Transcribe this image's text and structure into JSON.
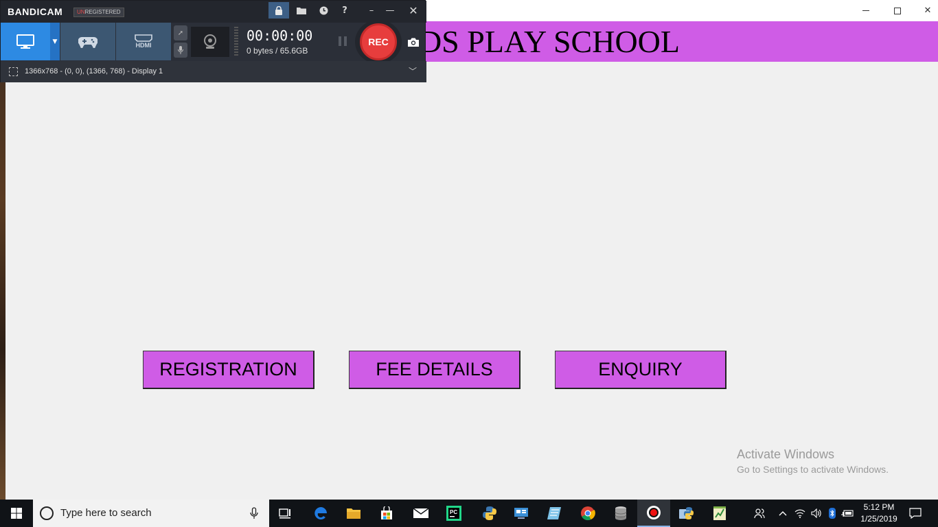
{
  "app": {
    "banner_title": "KRISHNA KIDS PLAY SCHOOL",
    "banner_color": "#cf5ce6",
    "buttons": {
      "registration": "REGISTRATION",
      "fee_details": "FEE DETAILS",
      "enquiry": "ENQUIRY"
    }
  },
  "watermark": {
    "title": "Activate Windows",
    "subtitle": "Go to Settings to activate Windows."
  },
  "bandicam": {
    "logo": "BANDICAM",
    "unregistered_prefix": "UN",
    "unregistered_rest": "REGISTERED",
    "hdmi_label": "HDMI",
    "timer": "00:00:00",
    "size": "0 bytes / 65.6GB",
    "rec_label": "REC",
    "region": "1366x768 - (0, 0), (1366, 768) - Display 1",
    "accent_color": "#2d8ae3",
    "rec_color": "#e73d3d"
  },
  "taskbar": {
    "search_placeholder": "Type here to search",
    "time": "5:12 PM",
    "date": "1/25/2019",
    "apps": [
      "task-view",
      "edge",
      "file-explorer",
      "store",
      "mail",
      "pycharm",
      "python",
      "network-app",
      "notes",
      "chrome",
      "database",
      "bandicam",
      "python-idle",
      "spreadsheet"
    ]
  }
}
